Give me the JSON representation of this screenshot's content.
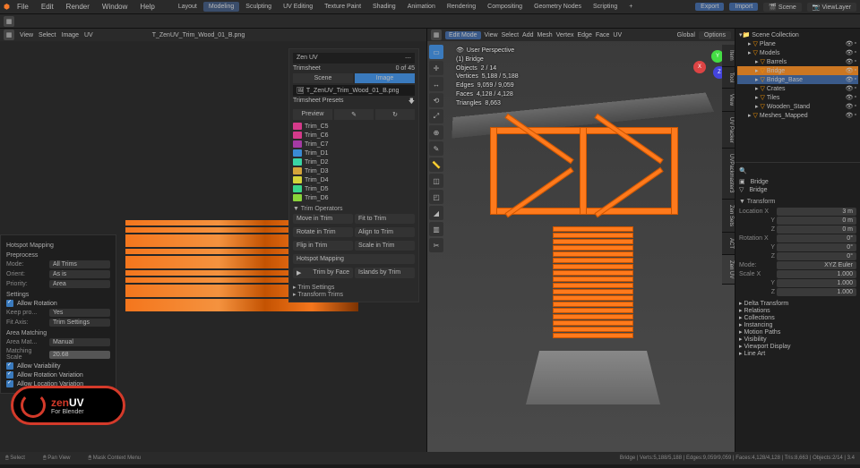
{
  "topbar": {
    "logo": "⚙",
    "menus": [
      "File",
      "Edit",
      "Render",
      "Window",
      "Help"
    ],
    "workspaces": [
      "Layout",
      "Modeling",
      "Sculpting",
      "UV Editing",
      "Texture Paint",
      "Shading",
      "Animation",
      "Rendering",
      "Compositing",
      "Geometry Nodes",
      "Scripting"
    ],
    "workspace_active": "Modeling",
    "export_btn": "Export",
    "import_btn": "Import",
    "scene_label": "Scene",
    "viewlayer_label": "ViewLayer"
  },
  "uv_header": {
    "menus": [
      "View",
      "Select",
      "Image",
      "UV"
    ],
    "texture_name": "T_ZenUV_Trim_Wood_01_B.png"
  },
  "hotspot": {
    "title": "Hotspot Mapping",
    "preprocess": "Preprocess",
    "mode_lbl": "Mode:",
    "mode_val": "All Trims",
    "orient_lbl": "Orient:",
    "orient_val": "As is",
    "priority_lbl": "Priority:",
    "priority_val": "Area",
    "settings": "Settings",
    "allow_rotation": "Allow Rotation",
    "keep_lbl": "Keep pro...",
    "keep_val": "Yes",
    "fit_lbl": "Fit Axis:",
    "fit_val": "Trim Settings",
    "area_matching": "Area Matching",
    "area_lbl": "Area Mat...",
    "area_val": "Manual",
    "scale_lbl": "Matching Scale",
    "scale_val": "20.68",
    "allow_variability": "Allow Variability",
    "allow_rot_var": "Allow Rotation Variation",
    "allow_loc_var": "Allow Location Variation"
  },
  "zen": {
    "title": "Zen UV",
    "trimsheet_lbl": "Trimsheet",
    "trimsheet_count": "0 of 45",
    "tab_scene": "Scene",
    "tab_image": "Image",
    "file": "T_ZenUV_Trim_Wood_01_B.png",
    "presets_lbl": "Trimsheet Presets",
    "preview_btn": "Preview",
    "trims": [
      {
        "name": "Trim_C5",
        "color": "#d43a8a"
      },
      {
        "name": "Trim_C6",
        "color": "#d43a8a"
      },
      {
        "name": "Trim_C7",
        "color": "#a43aa4"
      },
      {
        "name": "Trim_D1",
        "color": "#3a8ad4"
      },
      {
        "name": "Trim_D2",
        "color": "#3ad4a4"
      },
      {
        "name": "Trim_D3",
        "color": "#d4a43a"
      },
      {
        "name": "Trim_D4",
        "color": "#d4d43a"
      },
      {
        "name": "Trim_D5",
        "color": "#3ad48a"
      },
      {
        "name": "Trim_D6",
        "color": "#8ad43a"
      }
    ],
    "ops_hdr": "Trim Operators",
    "move": "Move in Trim",
    "fit": "Fit to Trim",
    "rotate": "Rotate in Trim",
    "align": "Align to Trim",
    "flip": "Flip in Trim",
    "scale": "Scale in Trim",
    "hotspot_map": "Hotspot Mapping",
    "trim_by_face": "Trim by Face",
    "islands_by_trim": "Islands by Trim",
    "trim_settings": "Trim Settings",
    "transform_trims": "Transform Trims"
  },
  "viewport": {
    "mode": "Edit Mode",
    "menus": [
      "View",
      "Select",
      "Add",
      "Mesh",
      "Vertex",
      "Edge",
      "Face",
      "UV"
    ],
    "global": "Global",
    "options": "Options",
    "perspective": "User Perspective",
    "object_name": "(1) Bridge",
    "stats": {
      "objects_lbl": "Objects",
      "objects_val": "2 / 14",
      "vertices_lbl": "Vertices",
      "vertices_val": "5,188 / 5,188",
      "edges_lbl": "Edges",
      "edges_val": "9,059 / 9,059",
      "faces_lbl": "Faces",
      "faces_val": "4,128 / 4,128",
      "tris_lbl": "Triangles",
      "tris_val": "8,663"
    },
    "vtabs": [
      "Item",
      "Tool",
      "View",
      "UV Packer",
      "UVPackmaster3",
      "Zen Sets",
      "ACT",
      "Zen UV"
    ]
  },
  "outliner": {
    "scene_collection": "Scene Collection",
    "items": [
      {
        "name": "Plane",
        "indent": 1
      },
      {
        "name": "Models",
        "indent": 1
      },
      {
        "name": "Barrels",
        "indent": 2
      },
      {
        "name": "Bridge",
        "indent": 2,
        "sel": true,
        "act": true
      },
      {
        "name": "Bridge_Base",
        "indent": 2,
        "sel": true
      },
      {
        "name": "Crates",
        "indent": 2
      },
      {
        "name": "Tiles",
        "indent": 2
      },
      {
        "name": "Wooden_Stand",
        "indent": 2
      },
      {
        "name": "Meshes_Mapped",
        "indent": 1
      }
    ]
  },
  "props": {
    "obj_name": "Bridge",
    "mesh_name": "Bridge",
    "transform_hdr": "Transform",
    "loc": {
      "lbl": "Location X",
      "x": "3 m",
      "y": "0 m",
      "z": "0 m"
    },
    "rot": {
      "lbl": "Rotation X",
      "x": "0°",
      "y": "0°",
      "z": "0°"
    },
    "mode_lbl": "Mode:",
    "mode_val": "XYZ Euler",
    "scale": {
      "lbl": "Scale X",
      "x": "1.000",
      "y": "1.000",
      "z": "1.000"
    },
    "sections": [
      "Delta Transform",
      "Relations",
      "Collections",
      "Instancing",
      "Motion Paths",
      "Visibility",
      "Viewport Display",
      "Line Art"
    ]
  },
  "statusbar": {
    "select": "Select",
    "pan": "Pan View",
    "context": "Mask Context Menu",
    "stats": "Bridge | Verts:5,188/5,188 | Edges:9,059/9,059 | Faces:4,128/4,128 | Tris:8,663 | Objects:2/14 | 3.4"
  },
  "logo": {
    "zen": "zen",
    "uv": "UV",
    "sub": "For Blender"
  }
}
